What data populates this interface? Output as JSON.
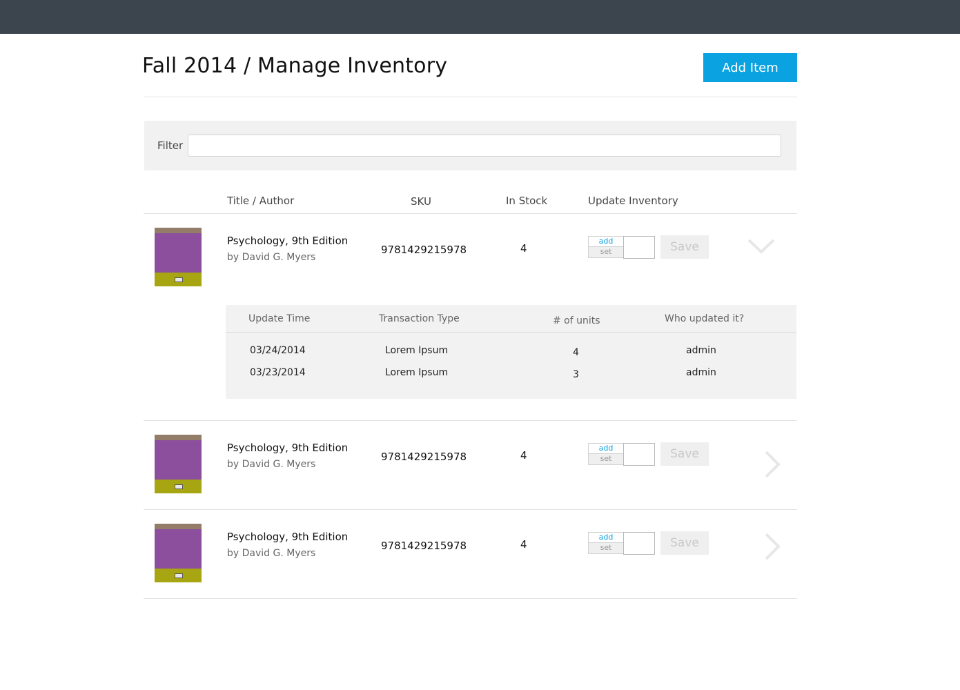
{
  "header": {
    "title": "Fall 2014 / Manage Inventory",
    "add_item_label": "Add Item"
  },
  "filter": {
    "label": "Filter",
    "value": "",
    "placeholder": ""
  },
  "columns": {
    "title_author": "Title / Author",
    "sku": "SKU",
    "in_stock": "In Stock",
    "update_inventory": "Update Inventory"
  },
  "rows": [
    {
      "title": "Psychology, 9th Edition",
      "author": "by David G. Myers",
      "sku": "9781429215978",
      "stock": "4",
      "add_label": "add",
      "set_label": "set",
      "quantity": "",
      "save_label": "Save",
      "expanded": true
    },
    {
      "title": "Psychology, 9th Edition",
      "author": "by David G. Myers",
      "sku": "9781429215978",
      "stock": "4",
      "add_label": "add",
      "set_label": "set",
      "quantity": "",
      "save_label": "Save",
      "expanded": false
    },
    {
      "title": "Psychology, 9th Edition",
      "author": "by David G. Myers",
      "sku": "9781429215978",
      "stock": "4",
      "add_label": "add",
      "set_label": "set",
      "quantity": "",
      "save_label": "Save",
      "expanded": false
    }
  ],
  "history": {
    "headers": {
      "update_time": "Update Time",
      "transaction_type": "Transaction Type",
      "units": "# of units",
      "who": "Who updated it?"
    },
    "entries": [
      {
        "time": "03/24/2014",
        "type": "Lorem Ipsum",
        "units": "4",
        "who": "admin"
      },
      {
        "time": "03/23/2014",
        "type": "Lorem Ipsum",
        "units": "3",
        "who": "admin"
      }
    ]
  },
  "colors": {
    "topbar": "#3c444d",
    "accent": "#0aa2e0",
    "cover_purple": "#8b4f9e",
    "cover_olive": "#a7a512"
  }
}
